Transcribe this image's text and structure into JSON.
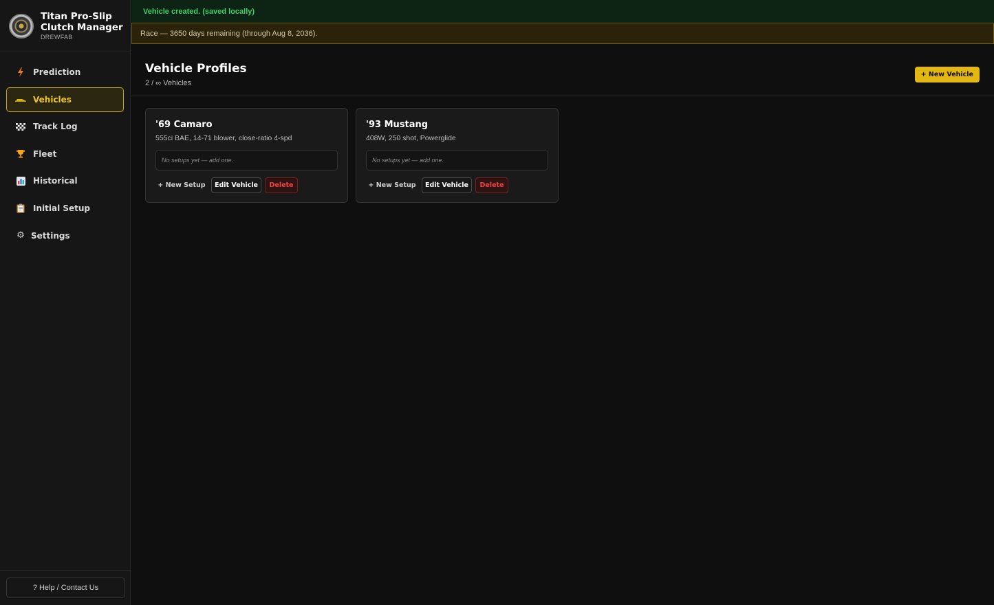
{
  "app": {
    "title": "Titan Pro-Slip Clutch Manager",
    "subtitle": "DREWFAB"
  },
  "sidebar": {
    "items": [
      {
        "label": "Prediction",
        "icon": "lightning-icon"
      },
      {
        "label": "Vehicles",
        "icon": "car-icon",
        "active": true
      },
      {
        "label": "Track Log",
        "icon": "checkered-flag-icon"
      },
      {
        "label": "Fleet",
        "icon": "trophy-icon"
      },
      {
        "label": "Historical",
        "icon": "bar-chart-icon"
      },
      {
        "label": "Initial Setup",
        "icon": "clipboard-icon"
      },
      {
        "label": "Settings",
        "icon": "gear-icon"
      }
    ],
    "help_label": "? Help / Contact Us"
  },
  "toast": {
    "text": "Vehicle created. (saved locally)"
  },
  "banner": {
    "text": "Race — 3650 days remaining (through Aug 8, 2036)."
  },
  "page": {
    "title": "Vehicle Profiles",
    "subtitle": "2 / ∞ Vehicles",
    "new_vehicle_label": "+ New Vehicle"
  },
  "vehicles": [
    {
      "name": "'69 Camaro",
      "description": "555ci BAE, 14-71 blower, close-ratio 4-spd",
      "setups_text": "No setups yet — add one.",
      "new_setup_label": "+ New Setup",
      "edit_label": "Edit Vehicle",
      "delete_label": "Delete"
    },
    {
      "name": "'93 Mustang",
      "description": "408W, 250 shot, Powerglide",
      "setups_text": "No setups yet — add one.",
      "new_setup_label": "+ New Setup",
      "edit_label": "Edit Vehicle",
      "delete_label": "Delete"
    }
  ],
  "colors": {
    "accent": "#e3b812",
    "success": "#3fd06a",
    "danger": "#ef4444",
    "background": "#0f0f0f"
  }
}
